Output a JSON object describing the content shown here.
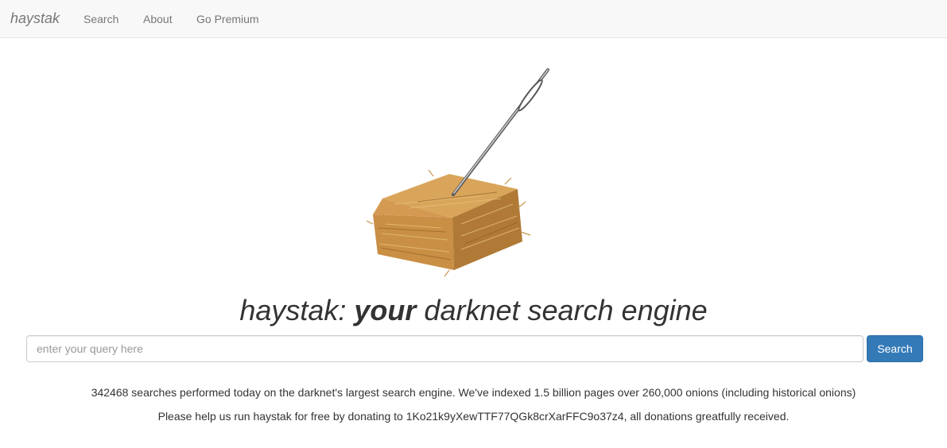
{
  "navbar": {
    "brand": "haystak",
    "links": [
      "Search",
      "About",
      "Go Premium"
    ]
  },
  "hero": {
    "image": "haystack-with-needle-icon"
  },
  "headline": {
    "prefix": "haystak: ",
    "emphasis": "your",
    "suffix": " darknet search engine"
  },
  "search": {
    "placeholder": "enter your query here",
    "value": "",
    "button_label": "Search"
  },
  "stats": {
    "line1": "342468 searches performed today on the darknet's largest search engine. We've indexed 1.5 billion pages over 260,000 onions (including historical onions)",
    "line2": "Please help us run haystak for free by donating to 1Ko21k9yXewTTF77QGk8crXarFFC9o37z4, all donations greatfully received."
  },
  "colors": {
    "navbar_bg": "#f8f8f8",
    "nav_text": "#777777",
    "button_primary": "#337ab7",
    "text": "#333333"
  }
}
